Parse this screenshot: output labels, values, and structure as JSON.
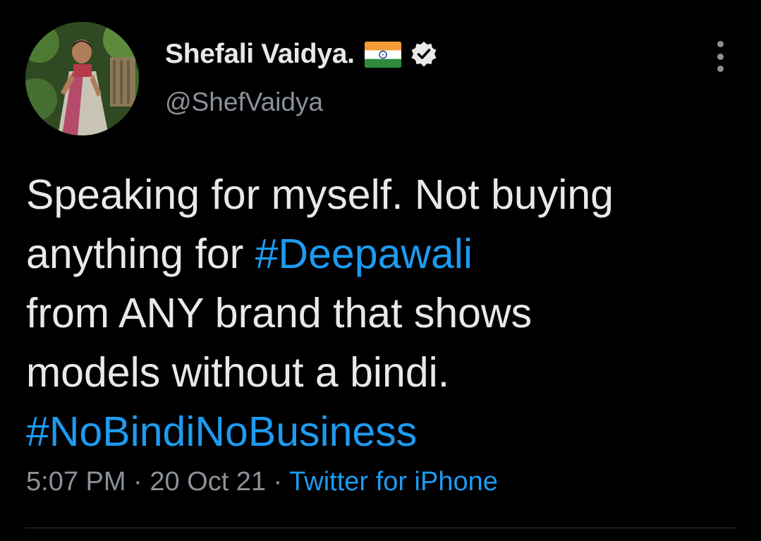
{
  "author": {
    "display_name": "Shefali Vaidya.",
    "handle": "@ShefVaidya",
    "flag_icon": "india-flag-icon",
    "verified_icon": "verified-badge-icon"
  },
  "tweet": {
    "lines": [
      [
        {
          "text": "Speaking for myself. Not buying",
          "type": "text"
        }
      ],
      [
        {
          "text": "anything for ",
          "type": "text"
        },
        {
          "text": "#Deepawali",
          "type": "hashtag"
        }
      ],
      [
        {
          "text": "from ANY brand that shows",
          "type": "text"
        }
      ],
      [
        {
          "text": "models without a bindi.",
          "type": "text"
        }
      ],
      [
        {
          "text": "#NoBindiNoBusiness",
          "type": "hashtag"
        }
      ]
    ]
  },
  "meta": {
    "time": "5:07 PM",
    "separator": " · ",
    "date": "20 Oct 21",
    "source": "Twitter for iPhone"
  },
  "colors": {
    "background": "#000000",
    "text": "#e7e9ea",
    "secondary": "#8b9199",
    "link": "#1d9bf0"
  }
}
